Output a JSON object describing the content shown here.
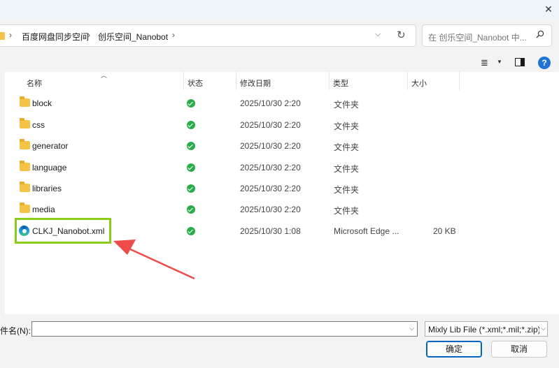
{
  "window": {
    "close_glyph": "✕"
  },
  "address": {
    "crumbs": [
      "百度网盘同步空间",
      "创乐空间_Nanobot"
    ],
    "sep": "›"
  },
  "search": {
    "placeholder": "在 创乐空间_Nanobot 中..."
  },
  "columns": {
    "name": "名称",
    "status": "状态",
    "date": "修改日期",
    "type": "类型",
    "size": "大小"
  },
  "files": [
    {
      "name": "block",
      "date": "2025/10/30 2:20",
      "type": "文件夹",
      "size": "",
      "kind": "folder"
    },
    {
      "name": "css",
      "date": "2025/10/30 2:20",
      "type": "文件夹",
      "size": "",
      "kind": "folder"
    },
    {
      "name": "generator",
      "date": "2025/10/30 2:20",
      "type": "文件夹",
      "size": "",
      "kind": "folder"
    },
    {
      "name": "language",
      "date": "2025/10/30 2:20",
      "type": "文件夹",
      "size": "",
      "kind": "folder"
    },
    {
      "name": "libraries",
      "date": "2025/10/30 2:20",
      "type": "文件夹",
      "size": "",
      "kind": "folder"
    },
    {
      "name": "media",
      "date": "2025/10/30 2:20",
      "type": "文件夹",
      "size": "",
      "kind": "folder"
    },
    {
      "name": "CLKJ_Nanobot.xml",
      "date": "2025/10/30 1:08",
      "type": "Microsoft Edge ...",
      "size": "20 KB",
      "kind": "xml"
    }
  ],
  "footer": {
    "filename_label": "件名(N):",
    "filename_value": "",
    "filetype_label": "Mixly Lib File (*.xml;*.mil;*.zip)",
    "ok_label": "确定",
    "cancel_label": "取消"
  },
  "toolbar": {
    "help_glyph": "?"
  },
  "colors": {
    "highlight": "#8ccd1a",
    "arrow": "#ef4b4b",
    "status_ok": "#2bac4a",
    "accent": "#0067c0"
  }
}
